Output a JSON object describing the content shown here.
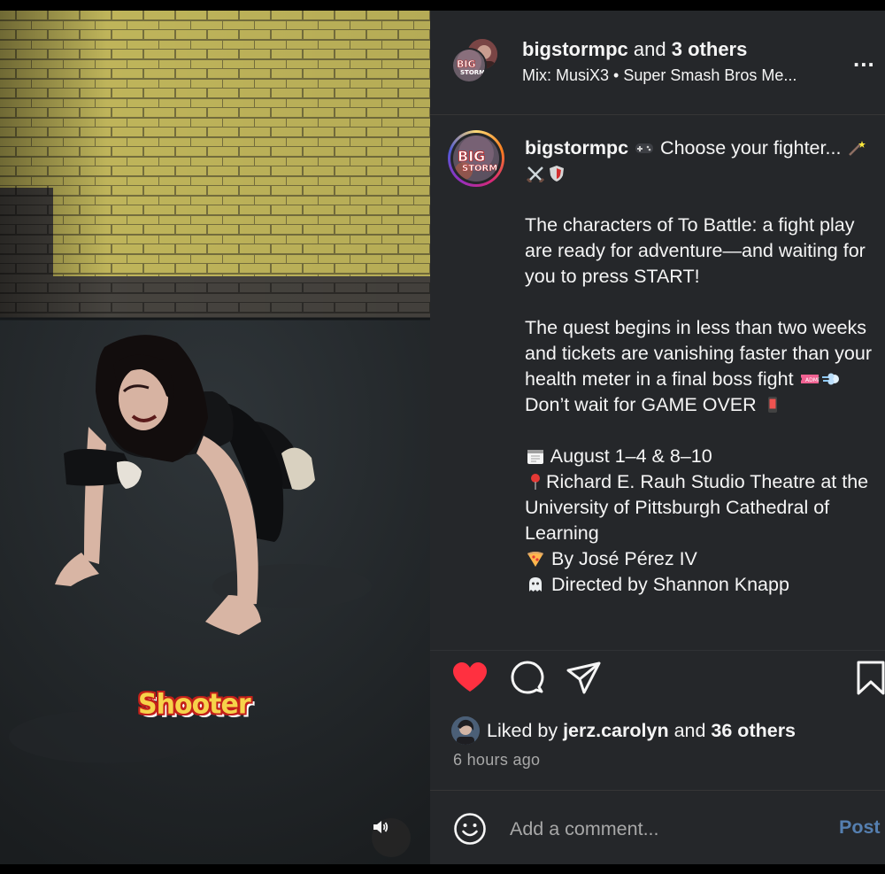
{
  "media": {
    "sticker_text": "Shooter",
    "audio_icon": "speaker-icon"
  },
  "header": {
    "author": "bigstormpc",
    "and_text": "and",
    "others": "3 others",
    "audio_track": "Mix: MusiX3 • Super Smash Bros Me...",
    "more_icon": "ellipsis-icon",
    "more_label": "..."
  },
  "avatar": {
    "logo_line1": "BIG",
    "logo_line2": "STORM"
  },
  "caption": {
    "username": "bigstormpc",
    "line1": "Choose your fighter...",
    "para1": "The characters of To Battle: a fight play are ready for adventure—and waiting for you to press START!",
    "para2a": "The quest begins in less than two weeks and tickets are vanishing faster than your health meter in a final boss fight",
    "para2b": "Don’t wait for GAME OVER",
    "dates": "August 1–4 & 8–10",
    "venue": "Richard E. Rauh Studio Theatre at the University of Pittsburgh Cathedral of Learning",
    "author_credit": "By José Pérez IV",
    "director_credit": "Directed by Shannon Knapp"
  },
  "actions": {
    "like_icon": "heart-icon",
    "comment_icon": "comment-icon",
    "share_icon": "share-icon",
    "save_icon": "bookmark-icon",
    "liked": true,
    "like_color": "#ff3040"
  },
  "likes": {
    "prefix": "Liked by",
    "user": "jerz.carolyn",
    "and_text": "and",
    "others": "36 others"
  },
  "timestamp": "6 hours ago",
  "comment": {
    "placeholder": "Add a comment...",
    "post_label": "Post",
    "emoji_icon": "smiley-icon"
  },
  "colors": {
    "panel_bg": "#25272a",
    "text": "#f5f5f5",
    "muted": "#a8a8a8",
    "post_link": "#557fb0"
  }
}
